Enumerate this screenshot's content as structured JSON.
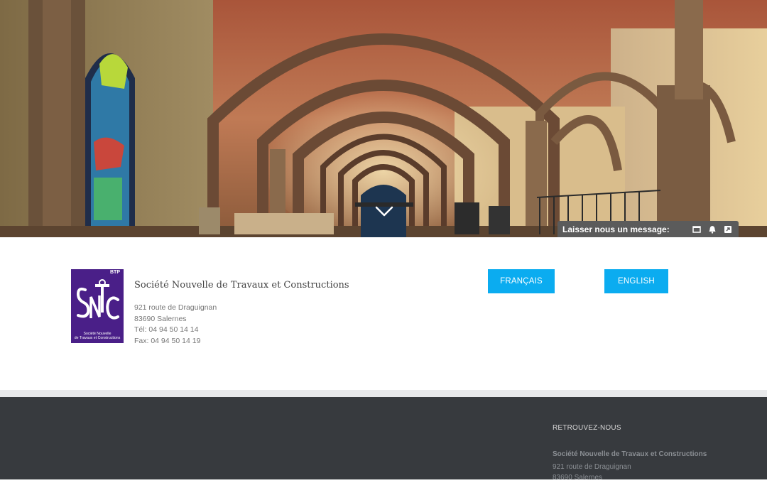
{
  "hero": {
    "chat": {
      "label": "Laisser nous un message:",
      "icons": [
        "minimize-icon",
        "bell-icon",
        "popout-icon"
      ]
    }
  },
  "logo": {
    "badge": "BTP",
    "caption_line1": "Société Nouvelle",
    "caption_line2": "de Travaux et Constructions",
    "color": "#4a1f88"
  },
  "contact": {
    "company": "Société Nouvelle de Travaux et Constructions",
    "address_lines": [
      "921 route de Draguignan",
      "83690 Salernes",
      "Tél: 04 94 50 14 14",
      "Fax: 04 94 50 14 19"
    ]
  },
  "languages": {
    "french": "FRANÇAIS",
    "english": "ENGLISH",
    "color": "#0bacf0"
  },
  "footer": {
    "heading": "RETROUVEZ-NOUS",
    "company": "Société Nouvelle de Travaux et Constructions",
    "address_lines": [
      "921 route de Draguignan",
      "83690 Salernes"
    ],
    "background": "#373a3e"
  }
}
